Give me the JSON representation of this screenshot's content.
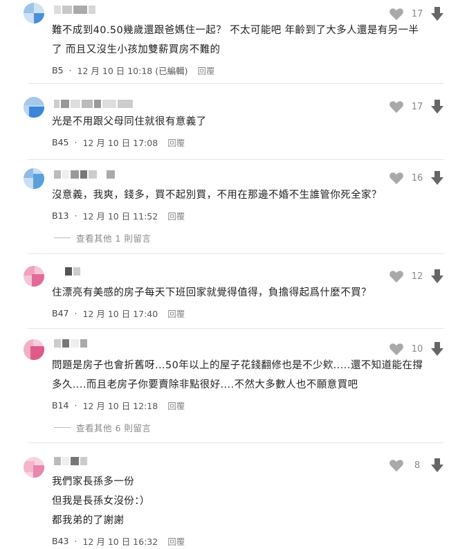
{
  "comments": [
    {
      "lines": [
        "難不成到40.50幾歲還跟爸媽住一起？ 不太可能吧 年齡到了大多人還是有另一半",
        "了 而且又沒生小孩加雙薪買房不難的"
      ],
      "floor": "B5",
      "time": "12 月 10 日 10:18 (已編輯)",
      "reply": "回覆",
      "likes": "17",
      "avatar_color": "#4a90d9"
    },
    {
      "lines": [
        "光是不用跟父母同住就很有意義了"
      ],
      "floor": "B45",
      "time": "12 月 10 日 17:08",
      "reply": "回覆",
      "likes": "17",
      "avatar_color": "#4a90d9"
    },
    {
      "lines": [
        "沒意義，我爽，錢多，買不起別買，不用在那邊不婚不生誰管你死全家？"
      ],
      "floor": "B13",
      "time": "12 月 10 日 11:52",
      "reply": "回覆",
      "likes": "16",
      "more": "查看其他 1 則留言",
      "avatar_color": "#5aa0dd"
    },
    {
      "lines": [
        "住漂亮有美感的房子每天下班回家就覺得值得，負擔得起爲什麼不買？"
      ],
      "floor": "B47",
      "time": "12 月 10 日 17:40",
      "reply": "回覆",
      "likes": "12",
      "avatar_color": "#e26a9a"
    },
    {
      "lines": [
        "問題是房子也會折舊呀...50年以上的屋子花錢翻修也是不少欸.....還不知道能在撐",
        "多久....而且老房子你要賣除非點很好....不然大多數人也不願意買吧"
      ],
      "floor": "B14",
      "time": "12 月 10 日 12:18",
      "reply": "回覆",
      "likes": "10",
      "more": "查看其他 6 則留言",
      "avatar_color": "#e05a8a"
    },
    {
      "lines": [
        "我們家長孫多一份",
        "但我是長孫女沒份：）",
        "都我弟的了謝謝"
      ],
      "floor": "B43",
      "time": "12 月 10 日 16:32",
      "reply": "回覆",
      "likes": "8",
      "avatar_color": "#ea85ad"
    }
  ]
}
